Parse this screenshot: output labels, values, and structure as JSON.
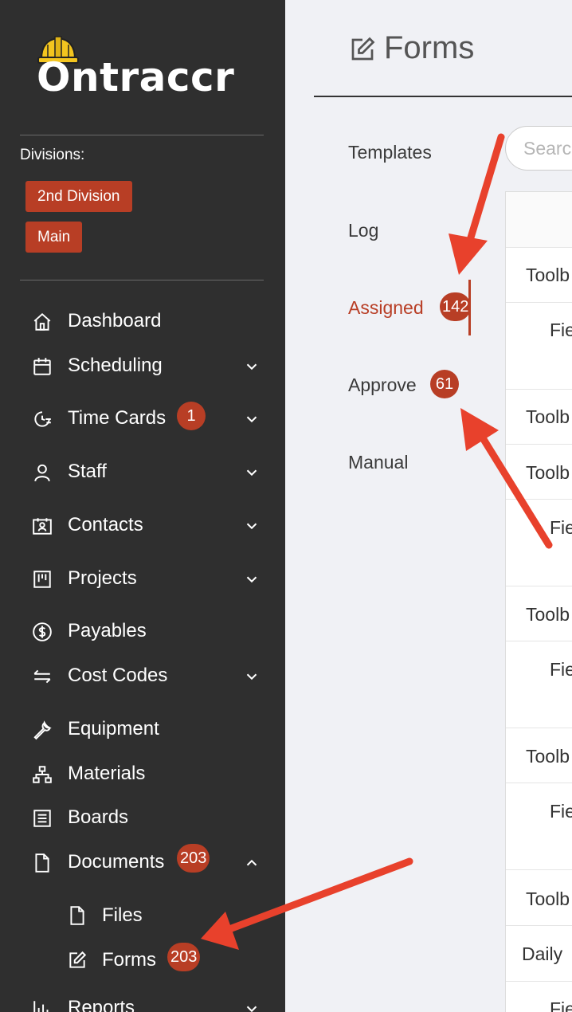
{
  "app": {
    "name": "Ontraccr"
  },
  "sidebar": {
    "divisions_label": "Divisions:",
    "divisions": [
      "2nd Division",
      "Main"
    ],
    "items": [
      {
        "label": "Dashboard",
        "icon": "home-icon"
      },
      {
        "label": "Scheduling",
        "icon": "calendar-icon",
        "expand": "chevron-down"
      },
      {
        "label": "Time Cards",
        "icon": "clock-icon",
        "badge": "1",
        "expand": "chevron-down"
      },
      {
        "label": "Staff",
        "icon": "user-icon",
        "expand": "chevron-down"
      },
      {
        "label": "Contacts",
        "icon": "contacts-icon",
        "expand": "chevron-down"
      },
      {
        "label": "Projects",
        "icon": "projects-icon",
        "expand": "chevron-down"
      },
      {
        "label": "Payables",
        "icon": "dollar-icon"
      },
      {
        "label": "Cost Codes",
        "icon": "swap-icon",
        "expand": "chevron-down"
      },
      {
        "label": "Equipment",
        "icon": "wrench-icon"
      },
      {
        "label": "Materials",
        "icon": "hierarchy-icon"
      },
      {
        "label": "Boards",
        "icon": "board-icon"
      },
      {
        "label": "Documents",
        "icon": "file-icon",
        "badge": "203",
        "expand": "chevron-up"
      },
      {
        "label": "Reports",
        "icon": "chart-icon",
        "expand": "chevron-down"
      }
    ],
    "documents_children": [
      {
        "label": "Files",
        "icon": "file-icon"
      },
      {
        "label": "Forms",
        "icon": "edit-icon",
        "badge": "203"
      }
    ]
  },
  "main": {
    "title": "Forms",
    "tabs": [
      {
        "label": "Templates"
      },
      {
        "label": "Log"
      },
      {
        "label": "Assigned",
        "badge": "142",
        "active": true
      },
      {
        "label": "Approve",
        "badge": "61"
      },
      {
        "label": "Manual"
      }
    ],
    "search_placeholder": "Search",
    "rows": [
      "Toolb",
      "Fie",
      "Toolb",
      "Toolb",
      "Fie",
      "Toolb",
      "Fie",
      "Toolb",
      "Fie",
      "Toolb",
      "Daily",
      "Fie"
    ]
  },
  "colors": {
    "accent": "#b83e25",
    "sidebar_bg": "#2f2f2f",
    "arrow": "#e8412c"
  }
}
